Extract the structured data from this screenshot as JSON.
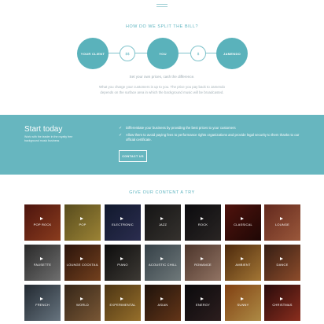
{
  "split": {
    "title": "HOW DO WE SPLIT THE BILL?",
    "nodes": {
      "client": "YOUR CLIENT",
      "you": "YOU",
      "jamendo": "JAMENDO",
      "money1": "$$",
      "money2": "$"
    },
    "caption": "Set your own prices, cash the difference.",
    "paragraph": "What you charge your customers is up to you. The price you pay back to Jamendo depends on the surface area in which the background music will be broadcasted."
  },
  "band": {
    "title": "Start today",
    "subtitle": "Work with the leader in the royalty free background music business",
    "bullets": [
      "Differentiate your business by providing the best prices to your customers",
      "Allow them to avoid paying fees to performance rights organizations and provide legal security to them thanks to our official certificate."
    ],
    "contact_label": "CONTACT US"
  },
  "try": {
    "title": "GIVE OUR CONTENT A TRY"
  },
  "tiles": [
    {
      "label": "POP ROCK",
      "colors": [
        "#6b1d14",
        "#c0542a"
      ]
    },
    {
      "label": "POP",
      "colors": [
        "#7a6a2a",
        "#d8b64a"
      ]
    },
    {
      "label": "ELECTRONIC",
      "colors": [
        "#18233f",
        "#3c3f6e"
      ]
    },
    {
      "label": "JAZZ",
      "colors": [
        "#1d1d1d",
        "#4a4540"
      ]
    },
    {
      "label": "ROCK",
      "colors": [
        "#101014",
        "#3a3432"
      ]
    },
    {
      "label": "CLASSICAL",
      "colors": [
        "#6e1a12",
        "#2b0b08"
      ]
    },
    {
      "label": "LOUNGE",
      "colors": [
        "#8a3a2a",
        "#d67a52"
      ]
    },
    {
      "label": "FAUSETTE",
      "colors": [
        "#3a3a3a",
        "#9a9a9a"
      ]
    },
    {
      "label": "LOUNGE COCKTAIL",
      "colors": [
        "#3c1c10",
        "#a05a2a"
      ]
    },
    {
      "label": "PIANO",
      "colors": [
        "#121212",
        "#555049"
      ]
    },
    {
      "label": "ACOUSTIC CHILL",
      "colors": [
        "#4a5a64",
        "#9aa7a9"
      ]
    },
    {
      "label": "ROMANCE",
      "colors": [
        "#6a4a3c",
        "#c9a08a"
      ]
    },
    {
      "label": "AMBIENT",
      "colors": [
        "#6b3a12",
        "#e2a44a"
      ]
    },
    {
      "label": "DANCE",
      "colors": [
        "#4a2a1c",
        "#c46a3c"
      ]
    },
    {
      "label": "FRENCH",
      "colors": [
        "#303a45",
        "#8fa1b0"
      ]
    },
    {
      "label": "WORLD",
      "colors": [
        "#4a3522",
        "#a8794a"
      ]
    },
    {
      "label": "EXPERIMENTAL",
      "colors": [
        "#6a4a1c",
        "#d09a3c"
      ]
    },
    {
      "label": "ASIAN",
      "colors": [
        "#2a1a10",
        "#8a4a22"
      ]
    },
    {
      "label": "ENERGY",
      "colors": [
        "#0e0e12",
        "#3e2a2a"
      ]
    },
    {
      "label": "SUNNY",
      "colors": [
        "#b35a1a",
        "#f0c060"
      ]
    },
    {
      "label": "CHRISTMAS",
      "colors": [
        "#3a1010",
        "#c0402a"
      ]
    }
  ]
}
